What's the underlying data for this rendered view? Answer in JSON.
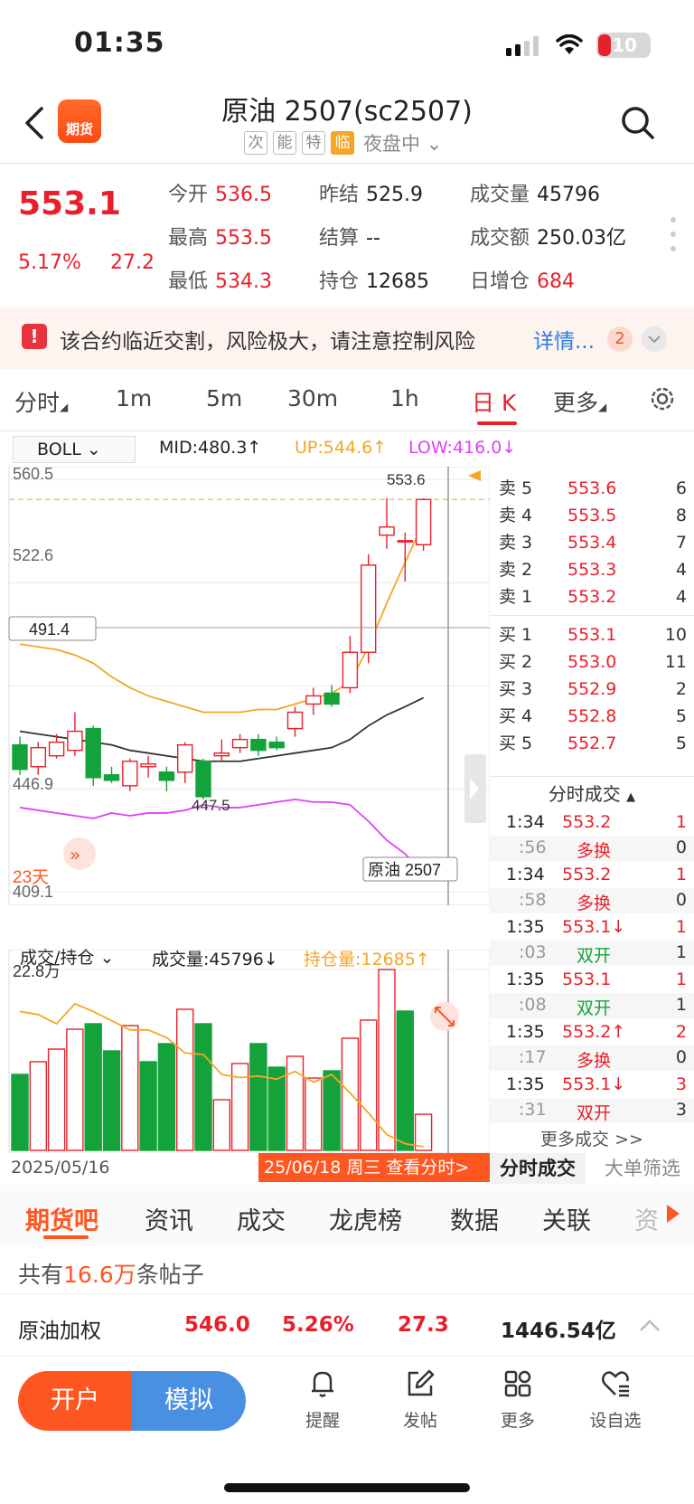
{
  "status": {
    "time": "01:35",
    "battery": "10"
  },
  "header": {
    "logo_text": "期货",
    "title": "原油 2507(sc2507)",
    "tags": [
      "次",
      "能",
      "特",
      "临"
    ],
    "session": "夜盘中"
  },
  "quote": {
    "last": "553.1",
    "pct": "5.17%",
    "chg": "27.2",
    "fields": [
      {
        "label": "今开",
        "value": "536.5",
        "color": "red"
      },
      {
        "label": "昨结",
        "value": "525.9",
        "color": "black"
      },
      {
        "label": "成交量",
        "value": "45796",
        "color": "black"
      },
      {
        "label": "最高",
        "value": "553.5",
        "color": "red"
      },
      {
        "label": "结算",
        "value": "--",
        "color": "black"
      },
      {
        "label": "成交额",
        "value": "250.03亿",
        "color": "black"
      },
      {
        "label": "最低",
        "value": "534.3",
        "color": "red"
      },
      {
        "label": "持仓",
        "value": "12685",
        "color": "black"
      },
      {
        "label": "日增仓",
        "value": "684",
        "color": "red"
      }
    ]
  },
  "risk": {
    "icon": "!",
    "text": "该合约临近交割，风险极大，请注意控制风险",
    "link": "详情...",
    "count": "2"
  },
  "period_tabs": [
    "分时",
    "1m",
    "5m",
    "30m",
    "1h",
    "日 K",
    "更多"
  ],
  "indicator": {
    "name": "BOLL",
    "mid": "MID:480.3↑",
    "up": "UP:544.6↑",
    "low": "LOW:416.0↓"
  },
  "kline": {
    "price_labels": [
      "560.5",
      "522.6",
      "446.9",
      "409.1"
    ],
    "hover_price": "491.4",
    "high_label": "553.6",
    "low_label": "447.5",
    "days_label": "23天",
    "name_badge": "原油 2507"
  },
  "volume": {
    "selector": "成交/持仓",
    "vol_text": "成交量:45796↓",
    "oi_text": "持仓量:12685↑",
    "max_label": "22.8万",
    "date_start": "2025/05/16",
    "date_badge": "25/06/18 周三 查看分时>"
  },
  "chart_data": {
    "type": "candlestick",
    "ylim": [
      409.1,
      560.5
    ],
    "candles": [
      {
        "o": 463,
        "c": 454,
        "h": 466,
        "l": 452
      },
      {
        "o": 455,
        "c": 462,
        "h": 464,
        "l": 452
      },
      {
        "o": 459,
        "c": 464,
        "h": 467,
        "l": 458
      },
      {
        "o": 461,
        "c": 468,
        "h": 475,
        "l": 459
      },
      {
        "o": 469,
        "c": 451,
        "h": 470,
        "l": 448
      },
      {
        "o": 452,
        "c": 450,
        "h": 455,
        "l": 449
      },
      {
        "o": 448,
        "c": 457,
        "h": 458,
        "l": 446
      },
      {
        "o": 455,
        "c": 456,
        "h": 459,
        "l": 451
      },
      {
        "o": 453,
        "c": 450,
        "h": 455,
        "l": 446
      },
      {
        "o": 453,
        "c": 463,
        "h": 464,
        "l": 449
      },
      {
        "o": 457,
        "c": 444,
        "h": 458,
        "l": 443
      },
      {
        "o": 459,
        "c": 460,
        "h": 465,
        "l": 457
      },
      {
        "o": 462,
        "c": 465,
        "h": 467,
        "l": 460
      },
      {
        "o": 465,
        "c": 461,
        "h": 467,
        "l": 459
      },
      {
        "o": 464,
        "c": 462,
        "h": 466,
        "l": 461
      },
      {
        "o": 469,
        "c": 475,
        "h": 477,
        "l": 466
      },
      {
        "o": 478,
        "c": 481,
        "h": 484,
        "l": 474
      },
      {
        "o": 482,
        "c": 478,
        "h": 485,
        "l": 477
      },
      {
        "o": 484,
        "c": 497,
        "h": 503,
        "l": 482
      },
      {
        "o": 497,
        "c": 529,
        "h": 533,
        "l": 493
      },
      {
        "o": 540,
        "c": 543,
        "h": 553.6,
        "l": 535
      },
      {
        "o": 538,
        "c": 538,
        "h": 541,
        "l": 523
      },
      {
        "o": 536.5,
        "c": 553.1,
        "h": 553.5,
        "l": 534.3
      }
    ],
    "mid": [
      468,
      467,
      466,
      465,
      464,
      463,
      461,
      460,
      459,
      458,
      457,
      457,
      457,
      458,
      459,
      460,
      461,
      462,
      465,
      470,
      474,
      477,
      480.3
    ],
    "up": [
      500,
      499,
      498,
      496,
      493,
      488,
      484,
      481,
      479,
      477,
      475,
      475,
      475,
      476,
      476,
      478,
      480,
      482,
      486,
      499,
      515,
      530,
      544.6
    ],
    "low": [
      440,
      439,
      438,
      437,
      436,
      438,
      437,
      438,
      438,
      439,
      441,
      440,
      440,
      441,
      442,
      443,
      442,
      442,
      441,
      435,
      428,
      423,
      416
    ],
    "volume": [
      0.42,
      0.49,
      0.56,
      0.67,
      0.7,
      0.55,
      0.69,
      0.49,
      0.59,
      0.78,
      0.7,
      0.28,
      0.48,
      0.59,
      0.46,
      0.52,
      0.4,
      0.44,
      0.62,
      0.72,
      1.0,
      0.77,
      0.2
    ],
    "volume_up": [
      false,
      true,
      true,
      true,
      false,
      false,
      true,
      false,
      false,
      true,
      false,
      true,
      true,
      false,
      false,
      true,
      true,
      false,
      true,
      true,
      true,
      false,
      true
    ],
    "open_interest": [
      0.88,
      0.86,
      0.8,
      0.93,
      0.88,
      0.82,
      0.76,
      0.76,
      0.71,
      0.61,
      0.6,
      0.47,
      0.45,
      0.46,
      0.44,
      0.49,
      0.42,
      0.47,
      0.35,
      0.22,
      0.08,
      0.02,
      0.0
    ]
  },
  "order_book": {
    "asks": [
      {
        "label": "卖 5",
        "price": "553.6",
        "vol": "6"
      },
      {
        "label": "卖 4",
        "price": "553.5",
        "vol": "8"
      },
      {
        "label": "卖 3",
        "price": "553.4",
        "vol": "7"
      },
      {
        "label": "卖 2",
        "price": "553.3",
        "vol": "4"
      },
      {
        "label": "卖 1",
        "price": "553.2",
        "vol": "4"
      }
    ],
    "bids": [
      {
        "label": "买 1",
        "price": "553.1",
        "vol": "10"
      },
      {
        "label": "买 2",
        "price": "553.0",
        "vol": "11"
      },
      {
        "label": "买 3",
        "price": "552.9",
        "vol": "2"
      },
      {
        "label": "买 4",
        "price": "552.8",
        "vol": "5"
      },
      {
        "label": "买 5",
        "price": "552.7",
        "vol": "5"
      }
    ]
  },
  "trades": {
    "title": "分时成交",
    "rows": [
      {
        "time": "1:34",
        "sec": ":56",
        "price": "553.2",
        "vol": "1",
        "kind": "多换",
        "oi": "0"
      },
      {
        "time": "1:34",
        "sec": ":58",
        "price": "553.2",
        "vol": "1",
        "kind": "多换",
        "oi": "0"
      },
      {
        "time": "1:35",
        "sec": ":03",
        "price": "553.1↓",
        "vol": "1",
        "kind": "双开",
        "oi": "1"
      },
      {
        "time": "1:35",
        "sec": ":08",
        "price": "553.1",
        "vol": "1",
        "kind": "双开",
        "oi": "1"
      },
      {
        "time": "1:35",
        "sec": ":17",
        "price": "553.2↑",
        "vol": "2",
        "kind": "多换",
        "oi": "0"
      },
      {
        "time": "1:35",
        "sec": ":31",
        "price": "553.1↓",
        "vol": "3",
        "kind": "双开",
        "oi": "3"
      }
    ],
    "more": "更多成交 >>",
    "tab_trades": "分时成交",
    "tab_bigorder": "大单筛选"
  },
  "content_tabs": [
    "期货吧",
    "资讯",
    "成交",
    "龙虎榜",
    "数据",
    "关联",
    "资"
  ],
  "posts": {
    "prefix": "共有",
    "count": "16.6万",
    "suffix": "条帖子"
  },
  "weighted": {
    "name": "原油加权",
    "price": "546.0",
    "pct": "5.26%",
    "chg": "27.3",
    "amount": "1446.54亿"
  },
  "bottom_nav": {
    "open": "开户",
    "simulate": "模拟",
    "items": [
      {
        "label": "提醒",
        "icon": "bell-icon"
      },
      {
        "label": "发帖",
        "icon": "compose-icon"
      },
      {
        "label": "更多",
        "icon": "grid-icon"
      },
      {
        "label": "设自选",
        "icon": "heart-list-icon"
      }
    ]
  }
}
